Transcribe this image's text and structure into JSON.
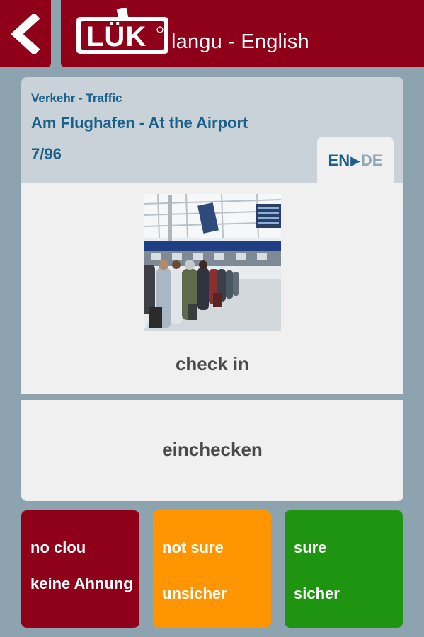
{
  "header": {
    "logo_text": "LÜK",
    "title": "langu - English"
  },
  "card": {
    "category": "Verkehr - Traffic",
    "topic": "Am Flughafen - At the Airport",
    "progress": "7/96",
    "lang_from": "EN",
    "lang_to": "DE",
    "question": "check in",
    "answer": "einchecken"
  },
  "ratings": {
    "no_clou": {
      "en": "no clou",
      "de": "keine Ahnung",
      "color": "#8f0019"
    },
    "not_sure": {
      "en": "not sure",
      "de": "unsicher",
      "color": "#ff9500"
    },
    "sure": {
      "en": "sure",
      "de": "sicher",
      "color": "#1e9410"
    }
  },
  "colors": {
    "brand": "#8f0019",
    "accent_text": "#19608a",
    "background": "#8da4b0"
  }
}
